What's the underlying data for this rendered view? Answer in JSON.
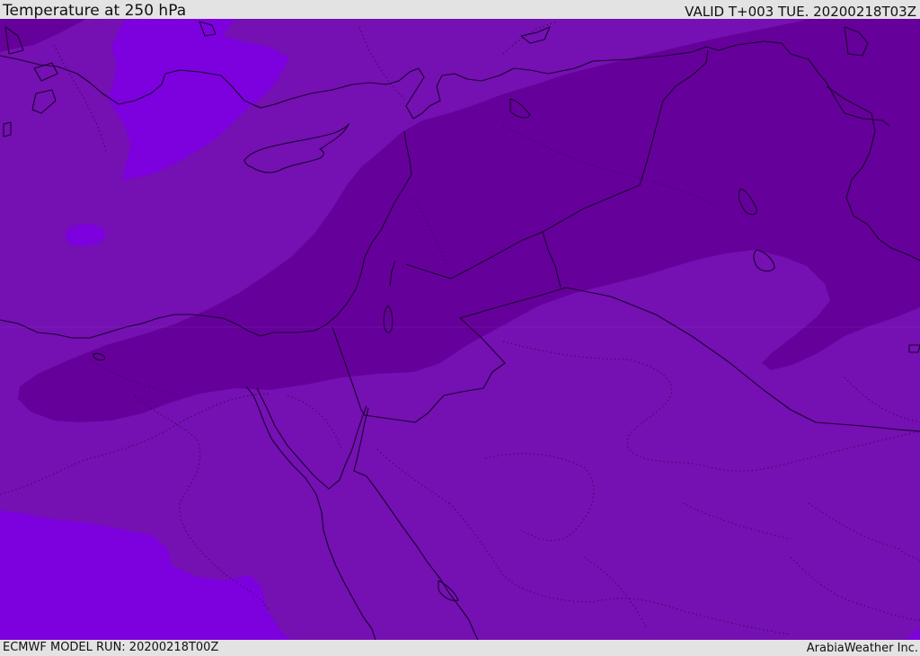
{
  "header": {
    "title": "Temperature at 250 hPa",
    "valid": "VALID T+003 TUE. 20200218T03Z"
  },
  "footer": {
    "model_run": "ECMWF MODEL RUN: 20200218T00Z",
    "credit": "ArabiaWeather Inc."
  },
  "colors": {
    "band_warm": "#7d00de",
    "band_mid": "#7510b2",
    "band_cold": "#66009a",
    "coastline": "#1a0030",
    "bar_background": "#e3e3e3"
  }
}
